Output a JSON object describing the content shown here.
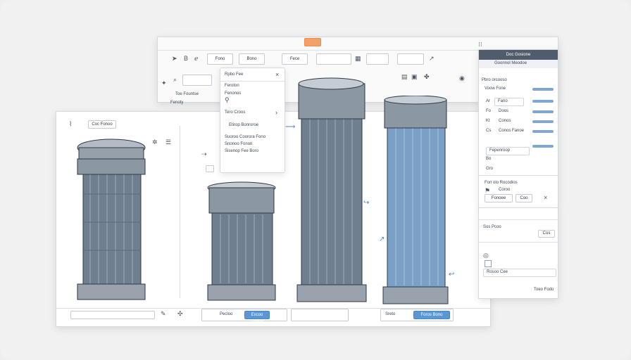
{
  "back_toolbar": {
    "items": [
      "Fono",
      "Bono",
      "Fece"
    ],
    "menu_labels": [
      "Toe Fountse",
      "Fenoty"
    ]
  },
  "main_window": {
    "tab_label": "Coc Fonoo",
    "bottom_buttons": [
      "Excoo Dodoo",
      "Foros Bono"
    ],
    "bottom_labels": [
      "Pecloo",
      "Sreto"
    ]
  },
  "dropdown": {
    "title": "Rpbo Fee",
    "items": [
      "Feroton",
      "Fenonos",
      "Tero Croos",
      "Etirop Bonroroe",
      "Suoroo Coorora Fono",
      "Snonoo Fonon",
      "Sisenop Fee Boro"
    ]
  },
  "right_panel": {
    "header_title": "Doc Gosione",
    "subheader": "Goonnol Meodoe",
    "section_title": "Pbro orcooso",
    "view_label": "Voow Fone",
    "fields": [
      {
        "label": "Ar",
        "value": "Fano"
      },
      {
        "label": "Fo",
        "value": "Doos"
      },
      {
        "label": "Kt",
        "value": "Conos"
      },
      {
        "label": "Cs",
        "value": "Conos Fanoe"
      }
    ],
    "extra_labels": [
      "Fepenroop",
      "Bo",
      "Gro"
    ],
    "bottom_title": "Fon olo Rocodios",
    "bottom_value": "Coroo",
    "buttons": [
      "Fonoee",
      "Coo"
    ]
  },
  "lower_panel": {
    "items": [
      "Sos Pcoo",
      "Rosoo Cee"
    ],
    "footer": "Toeo Fodo",
    "buttons": [
      "Cos"
    ]
  },
  "colors": {
    "accent_orange": "#f4a06a",
    "accent_blue": "#5a97d4"
  }
}
